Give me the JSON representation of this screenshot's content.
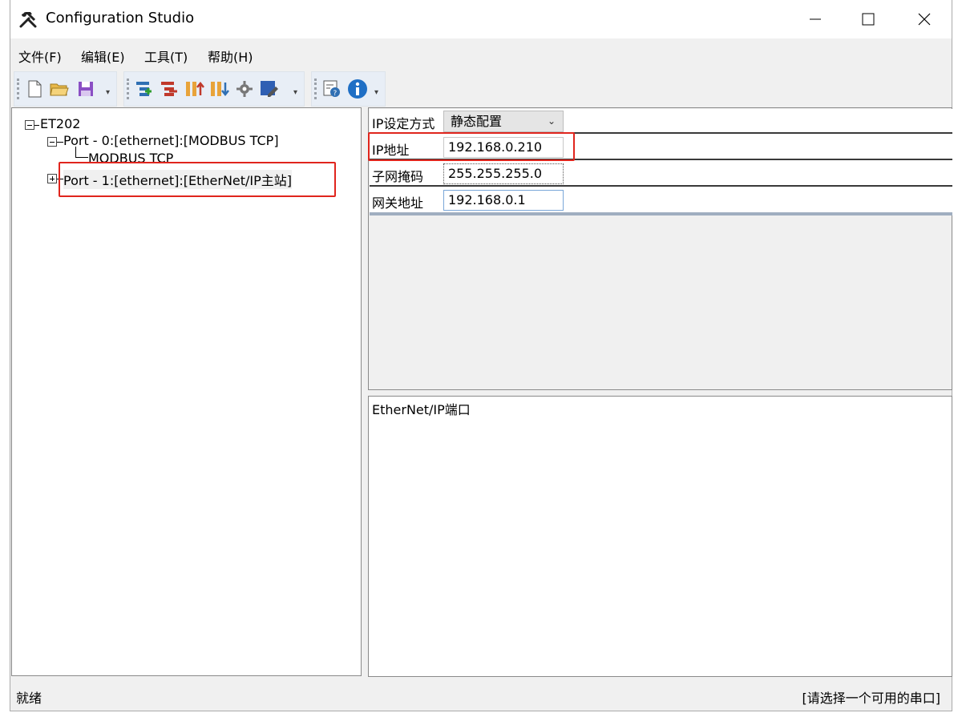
{
  "window": {
    "title": "Configuration Studio",
    "icon": "tools-icon"
  },
  "menu": [
    {
      "label": "文件(F)"
    },
    {
      "label": "编辑(E)"
    },
    {
      "label": "工具(T)"
    },
    {
      "label": "帮助(H)"
    }
  ],
  "toolbar": {
    "icons": [
      "new-file-icon",
      "open-folder-icon",
      "save-icon",
      "add-node-icon",
      "remove-node-icon",
      "upload-icon",
      "download-icon",
      "settings-gear-icon",
      "edit-icon",
      "help-doc-icon",
      "info-icon"
    ]
  },
  "tree": {
    "root": "ET202",
    "port0": "Port - 0:[ethernet]:[MODBUS TCP]",
    "port0_child": "MODBUS TCP",
    "port1": "Port - 1:[ethernet]:[EtherNet/IP主站]"
  },
  "properties": {
    "mode_label": "IP设定方式",
    "mode_value": "静态配置",
    "ip_label": "IP地址",
    "ip_value": "192.168.0.210",
    "mask_label": "子网掩码",
    "mask_value": "255.255.255.0",
    "gateway_label": "网关地址",
    "gateway_value": "192.168.0.1"
  },
  "description": "EtherNet/IP端口",
  "status": {
    "left": "就绪",
    "right": "[请选择一个可用的串口]"
  },
  "colors": {
    "highlight": "#e0251d",
    "accent_blue": "#1f6fc5"
  }
}
